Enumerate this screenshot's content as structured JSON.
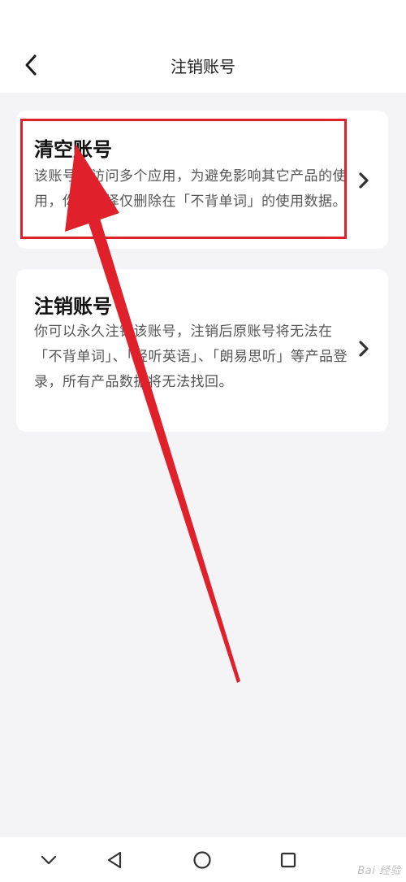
{
  "header": {
    "title": "注销账号",
    "back_icon": "chevron-left-icon"
  },
  "cards": {
    "clear": {
      "title": "清空账号",
      "description": "该账号可访问多个应用，为避免影响其它产品的使用，你可选择仅删除在「不背单词」的使用数据。",
      "chevron_icon": "chevron-right-icon"
    },
    "cancel": {
      "title": "注销账号",
      "description": "你可以永久注销该账号，注销后原账号将无法在「不背单词」、「轻听英语」、「朗易思听」等产品登录，所有产品数据将无法找回。",
      "chevron_icon": "chevron-right-icon"
    }
  },
  "annotation": {
    "highlight_color": "#e0202a",
    "arrow_color": "#e0202a"
  },
  "navbar": {
    "icons": [
      "chevron-down-icon",
      "back-triangle-icon",
      "home-circle-icon",
      "recent-square-icon"
    ]
  },
  "watermark": {
    "text": "Bai 经验"
  }
}
